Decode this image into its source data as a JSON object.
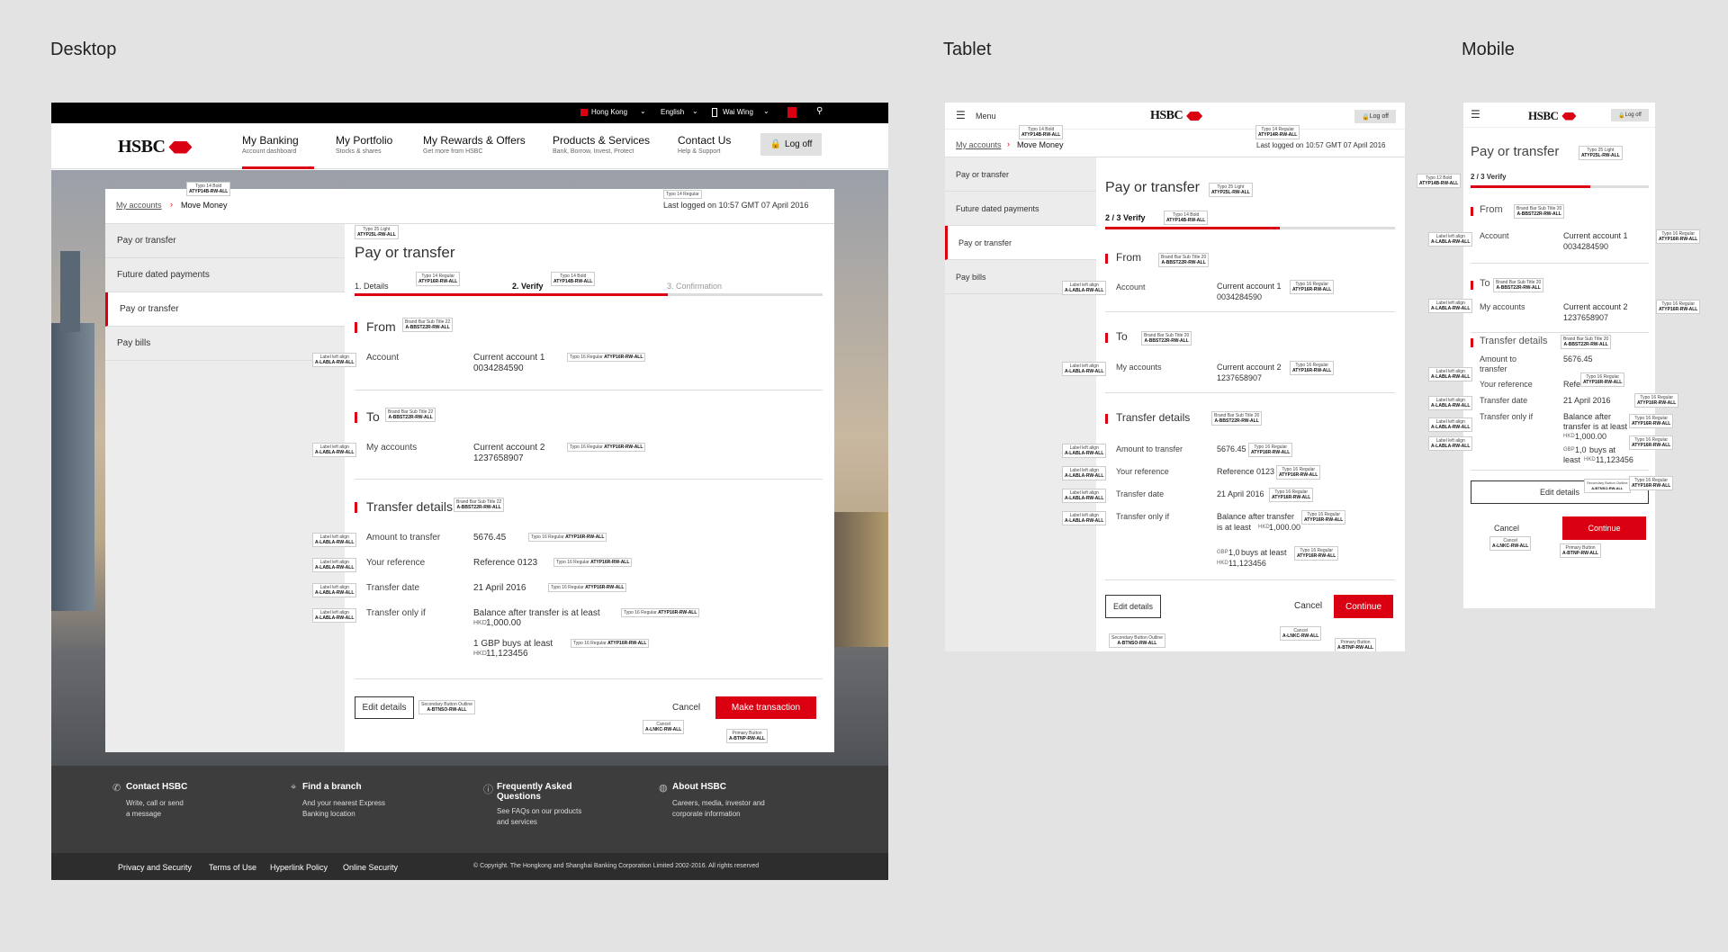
{
  "sections": {
    "desktop": "Desktop",
    "tablet": "Tablet",
    "mobile": "Mobile"
  },
  "brand": "HSBC",
  "topbar": {
    "region": "Hong Kong",
    "language": "English",
    "user": "Wai Wing"
  },
  "nav": [
    {
      "title": "My Banking",
      "sub": "Account dashboard"
    },
    {
      "title": "My Portfolio",
      "sub": "Stocks & shares"
    },
    {
      "title": "My Rewards & Offers",
      "sub": "Get more from HSBC"
    },
    {
      "title": "Products & Services",
      "sub": "Bank, Borrow, Invest, Protect"
    },
    {
      "title": "Contact Us",
      "sub": "Help & Support"
    }
  ],
  "logoff": "Log off",
  "logoff_small": "Log off",
  "menu": "Menu",
  "breadcrumb": {
    "parent": "My accounts",
    "current": "Move Money"
  },
  "last_logged": "Last logged on 10:57 GMT 07 April 2016",
  "sidebar": [
    "Pay or transfer",
    "Future dated payments",
    "Pay or transfer",
    "Pay bills"
  ],
  "page_title": "Pay or transfer",
  "steps": {
    "s1": "1. Details",
    "s2": "2. Verify",
    "s3": "3. Confirmation",
    "progress": "2 / 3 Verify",
    "progress_fraction": 0.67
  },
  "from": {
    "heading": "From",
    "label": "Account",
    "value": "Current account 1",
    "number": "0034284590"
  },
  "to": {
    "heading": "To",
    "label": "My accounts",
    "value": "Current account 2",
    "number": "1237658907"
  },
  "transfer": {
    "heading": "Transfer details",
    "amount_label": "Amount to transfer",
    "amount": "5676.45",
    "ref_label": "Your reference",
    "ref": "Reference 0123",
    "date_label": "Transfer date",
    "date": "21 April 2016",
    "only_label": "Transfer only if",
    "only": "Balance after transfer is at least",
    "only_t1": "Balance after transfer",
    "only_t2": "is at least",
    "only_m1": "Balance after",
    "only_m2": "transfer is at least",
    "hkd": "HKD",
    "min": "1,000.00",
    "gbp": "1 GBP buys at least",
    "rate": "11,123456",
    "gbp_code": "GBP",
    "gbp_amt": "1,0",
    "buys": "buys at least",
    "buys_m1": "buys at",
    "least": "least",
    "amount_m1": "Amount to",
    "amount_m2": "transfer"
  },
  "buttons": {
    "edit": "Edit details",
    "cancel": "Cancel",
    "make": "Make transaction",
    "continue": "Continue"
  },
  "footer": [
    {
      "title": "Contact HSBC",
      "l1": "Write, call or send",
      "l2": "a message"
    },
    {
      "title": "Find a branch",
      "l1": "And your nearest Express",
      "l2": "Banking location"
    },
    {
      "title": "Frequently Asked",
      "title2": "Questions",
      "l1": "See FAQs on our products",
      "l2": "and services"
    },
    {
      "title": "About HSBC",
      "l1": "Careers, media, investor and",
      "l2": "corporate information"
    }
  ],
  "footer_links": [
    "Privacy and Security",
    "Terms of Use",
    "Hyperlink Policy",
    "Online Security"
  ],
  "copyright": "© Copyright. The Hongkong and Shanghai Banking Corporation Limited 2002-2016. All rights reserved",
  "tags": {
    "t14b": [
      "Typo 14 Bold",
      "ATYP14B-RW-ALL"
    ],
    "t14r": [
      "Typo 14 Regular",
      "ATYP14R-RW-ALL"
    ],
    "t25l": [
      "Typo 25 Light",
      "ATYP25L-RW-ALL"
    ],
    "t16r": [
      "Typo 16 Regular",
      "ATYP16R-RW-ALL"
    ],
    "t16r2": [
      "Typo 16 Regular",
      "A-TYP16R-RW-ALL"
    ],
    "bb22": [
      "Brand Bar Sub Title 22",
      "A-BBST22R-RW-ALL"
    ],
    "bb20": [
      "Brand Bar Sub Title 20",
      "A-BBST22R-RW-ALL"
    ],
    "label": [
      "Label left align",
      "A-LABLA-RW-ALL"
    ],
    "sec": [
      "Secondary Button Outline",
      "A-BTNSO-RW-ALL"
    ],
    "cancel": [
      "Cancel",
      "A-LNKC-RW-ALL"
    ],
    "primary": [
      "Primary Button",
      "A-BTNP-RW-ALL"
    ],
    "t12b": [
      "Typo 12 Bold",
      "ATYP14B-RW-ALL"
    ]
  }
}
